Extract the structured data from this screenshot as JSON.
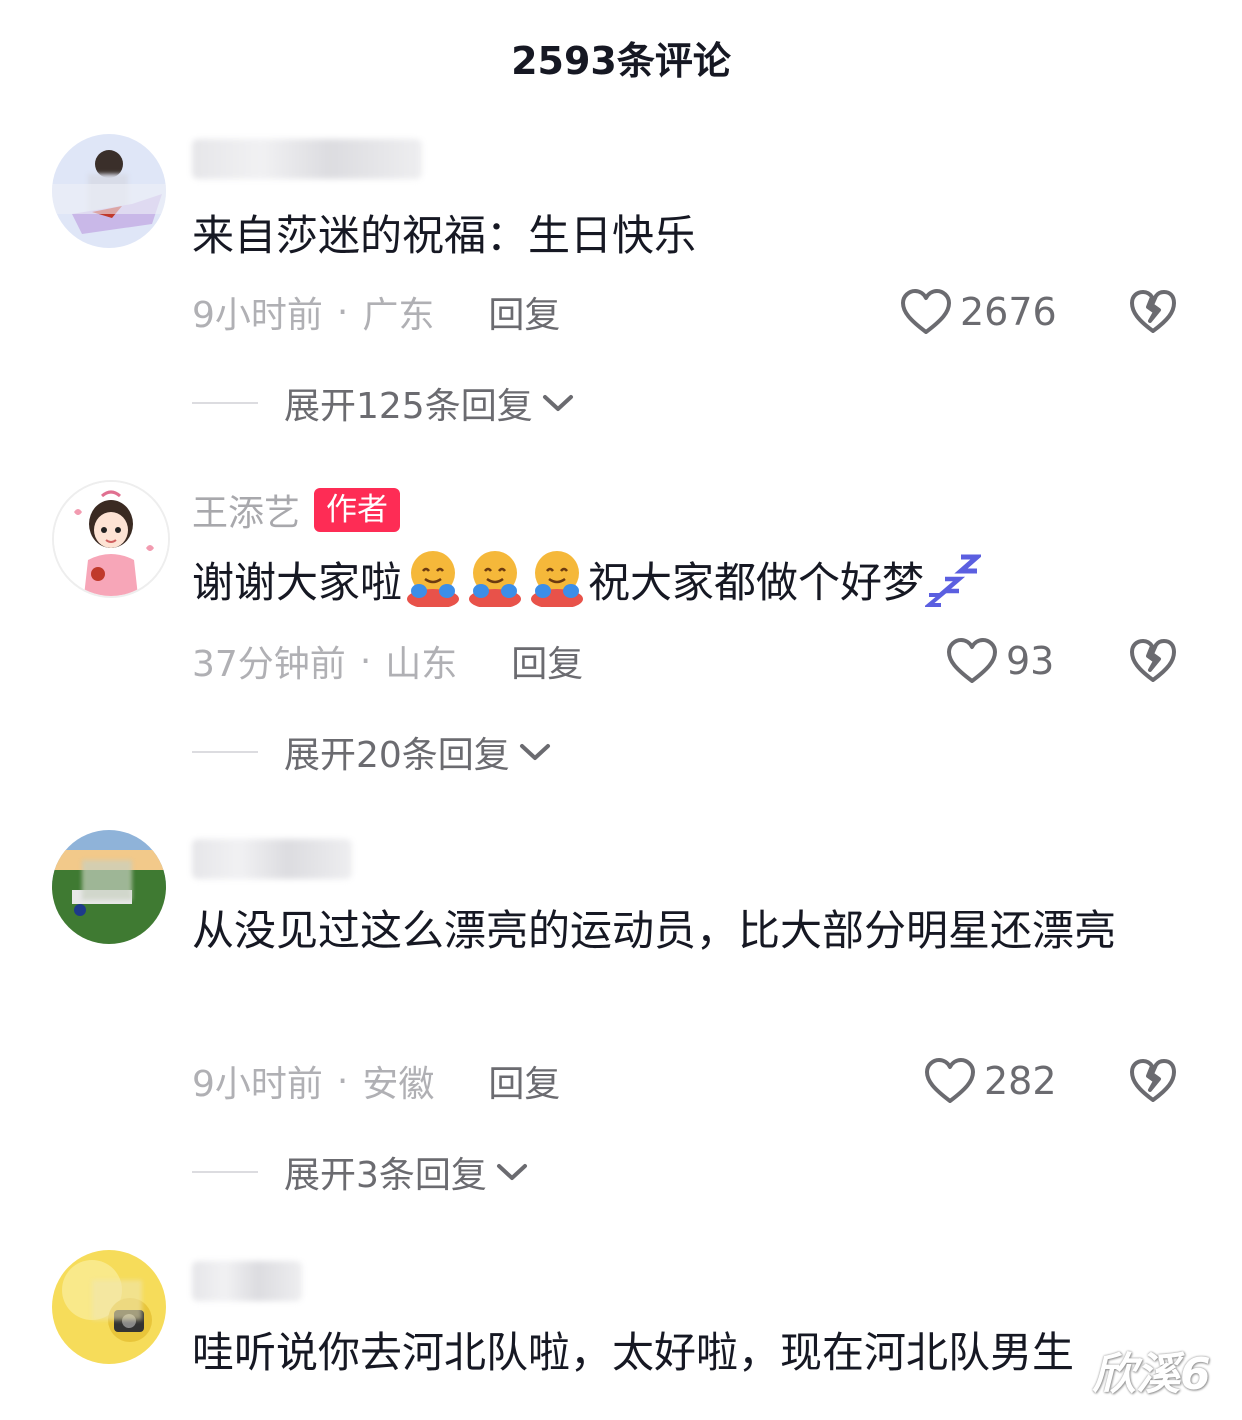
{
  "header": {
    "title": "2593条评论"
  },
  "comments": [
    {
      "username": "",
      "text": "来自莎迷的祝福：生日快乐",
      "time": "9小时前",
      "location": "广东",
      "reply_label": "回复",
      "likes": "2676",
      "expand_label": "展开125条回复"
    },
    {
      "username": "王添艺",
      "badge": "作者",
      "text": "谢谢大家啦",
      "text_tail": "祝大家都做个好梦",
      "time": "37分钟前",
      "location": "山东",
      "reply_label": "回复",
      "likes": "93",
      "expand_label": "展开20条回复"
    },
    {
      "username": "",
      "text": "从没见过这么漂亮的运动员，比大部分明星还漂亮",
      "time": "9小时前",
      "location": "安徽",
      "reply_label": "回复",
      "likes": "282",
      "expand_label": "展开3条回复"
    },
    {
      "username": "",
      "text": "哇听说你去河北队啦，太好啦，现在河北队男生"
    }
  ],
  "watermark": "欣溪6",
  "colors": {
    "author_badge": "#fe2c55",
    "meta_text": "#b0b0b4",
    "action_text": "#6b6b70"
  }
}
